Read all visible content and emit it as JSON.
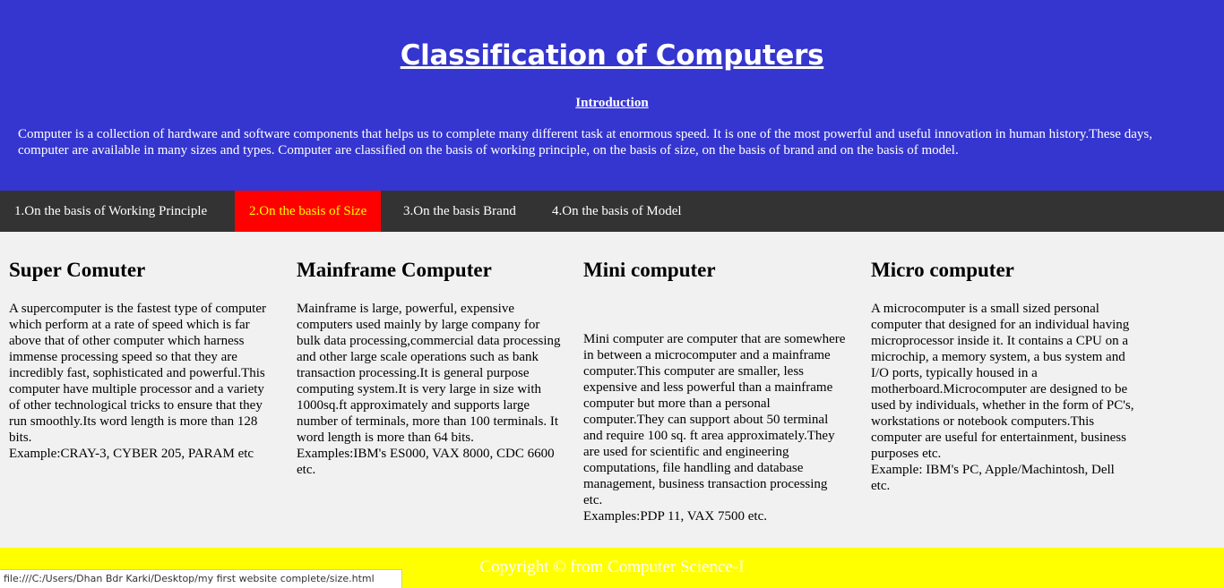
{
  "header": {
    "title": "Classification of Computers",
    "intro_heading": "Introduction",
    "intro_text": "Computer is a collection of hardware and software components that helps us to complete many different task at enormous speed. It is one of the most powerful and useful innovation in human history.These days, computer are available in many sizes and types. Computer are classified on the basis of working principle, on the basis of size, on the basis of brand and on the basis of model."
  },
  "nav": {
    "items": [
      {
        "label": "1.On the basis of Working Principle"
      },
      {
        "label": "2.On the basis of Size"
      },
      {
        "label": "3.On the basis Brand"
      },
      {
        "label": "4.On the basis of Model"
      }
    ],
    "active_index": 1
  },
  "columns": [
    {
      "heading": "Super Comuter",
      "text": "A supercomputer is the fastest type of computer which perform at a rate of speed which is far above that of other computer which harness immense processing speed so that they are incredibly fast, sophisticated and powerful.This computer have multiple processor and a variety of other technological tricks to ensure that they run smoothly.Its word length is more than 128 bits.",
      "example": "Example:CRAY-3, CYBER 205, PARAM etc"
    },
    {
      "heading": "Mainframe Computer",
      "text": "Mainframe is large, powerful, expensive computers used mainly by large company for bulk data processing,commercial data processing and other large scale operations such as bank transaction processing.It is general purpose computing system.It is very large in size with 1000sq.ft approximately and supports large number of terminals, more than 100 terminals. It word length is more than 64 bits.",
      "example": "Examples:IBM's ES000, VAX 8000, CDC 6600 etc."
    },
    {
      "heading": "Mini computer",
      "text": "Mini computer are computer that are somewhere in between a microcomputer and a mainframe computer.This computer are smaller, less expensive and less powerful than a mainframe computer but more than a personal computer.They can support about 50 terminal and require 100 sq. ft area approximately.They are used for scientific and engineering computations, file handling and database management, business transaction processing etc.",
      "example": "Examples:PDP 11, VAX 7500 etc."
    },
    {
      "heading": "Micro computer",
      "text": "A microcomputer is a small sized personal computer that designed for an individual having microprocessor inside it. It contains a CPU on a microchip, a memory system, a bus system and I/O ports, typically housed in a motherboard.Microcomputer are designed to be used by individuals, whether in the form of PC's, workstations or notebook computers.This computer are useful for entertainment, business purposes etc.",
      "example": "Example: IBM's PC, Apple/Machintosh, Dell etc."
    }
  ],
  "footer": {
    "text": "Copyright © from Computer Science-I"
  },
  "status_bar": {
    "url": "file:///C:/Users/Dhan Bdr Karki/Desktop/my first website complete/size.html"
  },
  "colors": {
    "header_bg": "#3535cf",
    "nav_bg": "#333333",
    "nav_active_bg": "#ff0000",
    "nav_active_text": "#ffff00",
    "content_bg": "#f1f1f1",
    "footer_bg": "#ffff00"
  }
}
